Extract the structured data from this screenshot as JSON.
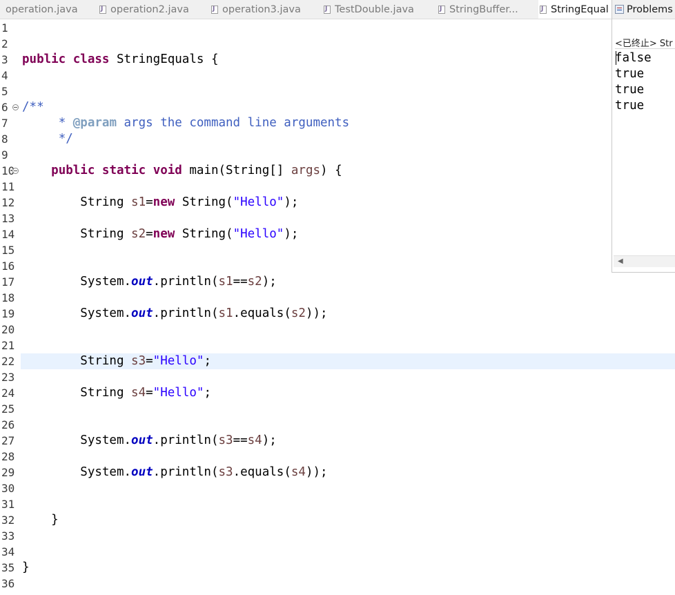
{
  "editor_tabs": [
    {
      "label": "operation.java",
      "active": false
    },
    {
      "label": "operation2.java",
      "active": false
    },
    {
      "label": "operation3.java",
      "active": false
    },
    {
      "label": "TestDouble.java",
      "active": false
    },
    {
      "label": "StringBuffer...",
      "active": false
    },
    {
      "label": "StringEqual",
      "active": true
    }
  ],
  "console": {
    "tab_label": "Problems",
    "terminated_label": "<已终止> Str",
    "output": [
      "false",
      "true",
      "true",
      "true"
    ]
  },
  "code": {
    "current_line": 22,
    "lines": [
      {
        "n": "1",
        "fold": false,
        "tokens": []
      },
      {
        "n": "2",
        "fold": false,
        "tokens": []
      },
      {
        "n": "3",
        "fold": false,
        "tokens": [
          [
            "kw",
            "public"
          ],
          [
            "p",
            " "
          ],
          [
            "kw",
            "class"
          ],
          [
            "p",
            " StringEquals {"
          ]
        ]
      },
      {
        "n": "4",
        "fold": false,
        "tokens": []
      },
      {
        "n": "5",
        "fold": false,
        "tokens": []
      },
      {
        "n": "6",
        "fold": true,
        "tokens": [
          [
            "cmt",
            "/**"
          ]
        ]
      },
      {
        "n": "7",
        "fold": false,
        "tokens": [
          [
            "p",
            "     "
          ],
          [
            "cmt",
            "* "
          ],
          [
            "tag",
            "@param"
          ],
          [
            "cmt",
            " args the command line arguments"
          ]
        ]
      },
      {
        "n": "8",
        "fold": false,
        "tokens": [
          [
            "p",
            "     "
          ],
          [
            "cmt",
            "*/"
          ]
        ]
      },
      {
        "n": "9",
        "fold": false,
        "tokens": []
      },
      {
        "n": "10",
        "fold": true,
        "tokens": [
          [
            "p",
            "    "
          ],
          [
            "kw",
            "public"
          ],
          [
            "p",
            " "
          ],
          [
            "kw",
            "static"
          ],
          [
            "p",
            " "
          ],
          [
            "kw",
            "void"
          ],
          [
            "p",
            " main(String[] "
          ],
          [
            "var",
            "args"
          ],
          [
            "p",
            ") {"
          ]
        ]
      },
      {
        "n": "11",
        "fold": false,
        "tokens": []
      },
      {
        "n": "12",
        "fold": false,
        "tokens": [
          [
            "p",
            "        String "
          ],
          [
            "var",
            "s1"
          ],
          [
            "p",
            "="
          ],
          [
            "kw",
            "new"
          ],
          [
            "p",
            " String("
          ],
          [
            "str",
            "\"Hello\""
          ],
          [
            "p",
            ");"
          ]
        ]
      },
      {
        "n": "13",
        "fold": false,
        "tokens": []
      },
      {
        "n": "14",
        "fold": false,
        "tokens": [
          [
            "p",
            "        String "
          ],
          [
            "var",
            "s2"
          ],
          [
            "p",
            "="
          ],
          [
            "kw",
            "new"
          ],
          [
            "p",
            " String("
          ],
          [
            "str",
            "\"Hello\""
          ],
          [
            "p",
            ");"
          ]
        ]
      },
      {
        "n": "15",
        "fold": false,
        "tokens": []
      },
      {
        "n": "16",
        "fold": false,
        "tokens": []
      },
      {
        "n": "17",
        "fold": false,
        "tokens": [
          [
            "p",
            "        System."
          ],
          [
            "fld",
            "out"
          ],
          [
            "p",
            ".println("
          ],
          [
            "var",
            "s1"
          ],
          [
            "p",
            "=="
          ],
          [
            "var",
            "s2"
          ],
          [
            "p",
            ");"
          ]
        ]
      },
      {
        "n": "18",
        "fold": false,
        "tokens": []
      },
      {
        "n": "19",
        "fold": false,
        "tokens": [
          [
            "p",
            "        System."
          ],
          [
            "fld",
            "out"
          ],
          [
            "p",
            ".println("
          ],
          [
            "var",
            "s1"
          ],
          [
            "p",
            ".equals("
          ],
          [
            "var",
            "s2"
          ],
          [
            "p",
            "));"
          ]
        ]
      },
      {
        "n": "20",
        "fold": false,
        "tokens": []
      },
      {
        "n": "21",
        "fold": false,
        "tokens": []
      },
      {
        "n": "22",
        "fold": false,
        "tokens": [
          [
            "p",
            "        String "
          ],
          [
            "var",
            "s3"
          ],
          [
            "p",
            "="
          ],
          [
            "str",
            "\"Hello\""
          ],
          [
            "p",
            ";"
          ]
        ]
      },
      {
        "n": "23",
        "fold": false,
        "tokens": []
      },
      {
        "n": "24",
        "fold": false,
        "tokens": [
          [
            "p",
            "        String "
          ],
          [
            "var",
            "s4"
          ],
          [
            "p",
            "="
          ],
          [
            "str",
            "\"Hello\""
          ],
          [
            "p",
            ";"
          ]
        ]
      },
      {
        "n": "25",
        "fold": false,
        "tokens": []
      },
      {
        "n": "26",
        "fold": false,
        "tokens": []
      },
      {
        "n": "27",
        "fold": false,
        "tokens": [
          [
            "p",
            "        System."
          ],
          [
            "fld",
            "out"
          ],
          [
            "p",
            ".println("
          ],
          [
            "var",
            "s3"
          ],
          [
            "p",
            "=="
          ],
          [
            "var",
            "s4"
          ],
          [
            "p",
            ");"
          ]
        ]
      },
      {
        "n": "28",
        "fold": false,
        "tokens": []
      },
      {
        "n": "29",
        "fold": false,
        "tokens": [
          [
            "p",
            "        System."
          ],
          [
            "fld",
            "out"
          ],
          [
            "p",
            ".println("
          ],
          [
            "var",
            "s3"
          ],
          [
            "p",
            ".equals("
          ],
          [
            "var",
            "s4"
          ],
          [
            "p",
            "));"
          ]
        ]
      },
      {
        "n": "30",
        "fold": false,
        "tokens": []
      },
      {
        "n": "31",
        "fold": false,
        "tokens": []
      },
      {
        "n": "32",
        "fold": false,
        "tokens": [
          [
            "p",
            "    }"
          ]
        ]
      },
      {
        "n": "33",
        "fold": false,
        "tokens": []
      },
      {
        "n": "34",
        "fold": false,
        "tokens": []
      },
      {
        "n": "35",
        "fold": false,
        "tokens": [
          [
            "p",
            "}"
          ]
        ]
      },
      {
        "n": "36",
        "fold": false,
        "tokens": []
      }
    ]
  }
}
